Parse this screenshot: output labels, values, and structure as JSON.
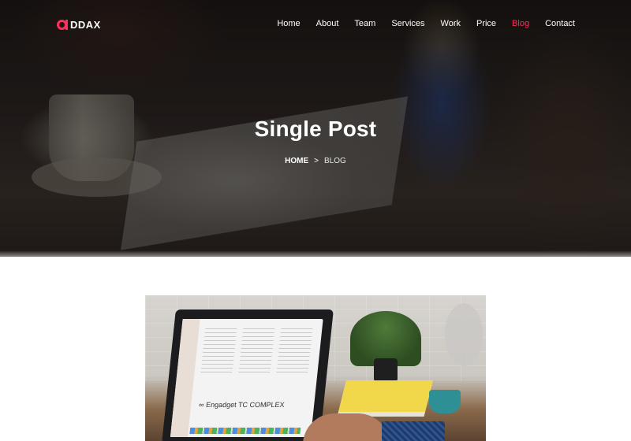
{
  "brand": {
    "logo_text": "DDAX",
    "accent_color": "#ff2e5c"
  },
  "nav": {
    "items": [
      {
        "label": "Home"
      },
      {
        "label": "About"
      },
      {
        "label": "Team"
      },
      {
        "label": "Services"
      },
      {
        "label": "Work"
      },
      {
        "label": "Price"
      },
      {
        "label": "Blog",
        "active": true
      },
      {
        "label": "Contact"
      }
    ]
  },
  "hero": {
    "title": "Single Post",
    "breadcrumb": {
      "home": "HOME",
      "separator": ">",
      "current": "BLOG"
    }
  },
  "post": {
    "screen_logos": "∞ Engadget TC COMPLEX"
  }
}
